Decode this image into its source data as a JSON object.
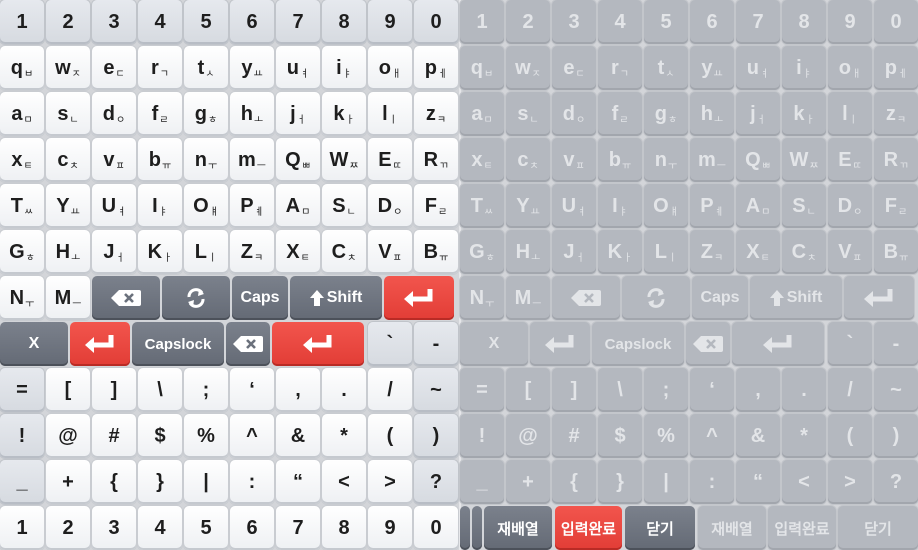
{
  "rows": [
    {
      "left": [
        {
          "p": "1",
          "s": "",
          "st": "l"
        },
        {
          "p": "2",
          "s": "",
          "st": "l"
        },
        {
          "p": "3",
          "s": "",
          "st": "l"
        },
        {
          "p": "4",
          "s": "",
          "st": "l"
        },
        {
          "p": "5",
          "s": "",
          "st": "l"
        },
        {
          "p": "6",
          "s": "",
          "st": "l"
        },
        {
          "p": "7",
          "s": "",
          "st": "l"
        },
        {
          "p": "8",
          "s": "",
          "st": "l"
        },
        {
          "p": "9",
          "s": "",
          "st": "l"
        },
        {
          "p": "0",
          "s": "",
          "st": "l"
        }
      ]
    },
    {
      "left": [
        {
          "p": "q",
          "s": "ㅂ",
          "st": "w"
        },
        {
          "p": "w",
          "s": "ㅈ",
          "st": "w"
        },
        {
          "p": "e",
          "s": "ㄷ",
          "st": "w"
        },
        {
          "p": "r",
          "s": "ㄱ",
          "st": "w"
        },
        {
          "p": "t",
          "s": "ㅅ",
          "st": "w"
        },
        {
          "p": "y",
          "s": "ㅛ",
          "st": "w"
        },
        {
          "p": "u",
          "s": "ㅕ",
          "st": "w"
        },
        {
          "p": "i",
          "s": "ㅑ",
          "st": "w"
        },
        {
          "p": "o",
          "s": "ㅐ",
          "st": "w"
        },
        {
          "p": "p",
          "s": "ㅔ",
          "st": "w"
        }
      ]
    },
    {
      "left": [
        {
          "p": "a",
          "s": "ㅁ",
          "st": "w"
        },
        {
          "p": "s",
          "s": "ㄴ",
          "st": "w"
        },
        {
          "p": "d",
          "s": "ㅇ",
          "st": "w"
        },
        {
          "p": "f",
          "s": "ㄹ",
          "st": "w"
        },
        {
          "p": "g",
          "s": "ㅎ",
          "st": "w"
        },
        {
          "p": "h",
          "s": "ㅗ",
          "st": "w"
        },
        {
          "p": "j",
          "s": "ㅓ",
          "st": "w"
        },
        {
          "p": "k",
          "s": "ㅏ",
          "st": "w"
        },
        {
          "p": "l",
          "s": "ㅣ",
          "st": "w"
        },
        {
          "p": "z",
          "s": "ㅋ",
          "st": "w"
        }
      ]
    },
    {
      "left": [
        {
          "p": "x",
          "s": "ㅌ",
          "st": "w"
        },
        {
          "p": "c",
          "s": "ㅊ",
          "st": "w"
        },
        {
          "p": "v",
          "s": "ㅍ",
          "st": "w"
        },
        {
          "p": "b",
          "s": "ㅠ",
          "st": "w"
        },
        {
          "p": "n",
          "s": "ㅜ",
          "st": "w"
        },
        {
          "p": "m",
          "s": "ㅡ",
          "st": "w"
        },
        {
          "p": "Q",
          "s": "ㅃ",
          "st": "w"
        },
        {
          "p": "W",
          "s": "ㅉ",
          "st": "w"
        },
        {
          "p": "E",
          "s": "ㄸ",
          "st": "w"
        },
        {
          "p": "R",
          "s": "ㄲ",
          "st": "w"
        }
      ]
    },
    {
      "left": [
        {
          "p": "T",
          "s": "ㅆ",
          "st": "w"
        },
        {
          "p": "Y",
          "s": "ㅛ",
          "st": "w"
        },
        {
          "p": "U",
          "s": "ㅕ",
          "st": "w"
        },
        {
          "p": "I",
          "s": "ㅑ",
          "st": "w"
        },
        {
          "p": "O",
          "s": "ㅒ",
          "st": "w"
        },
        {
          "p": "P",
          "s": "ㅖ",
          "st": "w"
        },
        {
          "p": "A",
          "s": "ㅁ",
          "st": "w"
        },
        {
          "p": "S",
          "s": "ㄴ",
          "st": "w"
        },
        {
          "p": "D",
          "s": "ㅇ",
          "st": "w"
        },
        {
          "p": "F",
          "s": "ㄹ",
          "st": "w"
        }
      ]
    },
    {
      "left": [
        {
          "p": "G",
          "s": "ㅎ",
          "st": "w"
        },
        {
          "p": "H",
          "s": "ㅗ",
          "st": "w"
        },
        {
          "p": "J",
          "s": "ㅓ",
          "st": "w"
        },
        {
          "p": "K",
          "s": "ㅏ",
          "st": "w"
        },
        {
          "p": "L",
          "s": "ㅣ",
          "st": "w"
        },
        {
          "p": "Z",
          "s": "ㅋ",
          "st": "w"
        },
        {
          "p": "X",
          "s": "ㅌ",
          "st": "w"
        },
        {
          "p": "C",
          "s": "ㅊ",
          "st": "w"
        },
        {
          "p": "V",
          "s": "ㅍ",
          "st": "w"
        },
        {
          "p": "B",
          "s": "ㅠ",
          "st": "w"
        }
      ]
    },
    {
      "left": [
        {
          "p": "N",
          "s": "ㅜ",
          "st": "w"
        },
        {
          "p": "M",
          "s": "ㅡ",
          "st": "w"
        },
        {
          "icon": "backspace-icon",
          "st": "d"
        },
        {
          "icon": "refresh-icon",
          "st": "d"
        },
        {
          "p": "Caps",
          "s": "",
          "st": "d",
          "lab": 1
        },
        {
          "p": "Shift",
          "s": "",
          "st": "d",
          "lab": 1,
          "icon": "shift-arrow-icon"
        },
        {
          "icon": "enter-icon",
          "st": "r"
        }
      ]
    },
    {
      "left": [
        {
          "p": "X",
          "s": "",
          "st": "d",
          "lab": 1
        },
        {
          "icon": "enter-icon",
          "st": "r"
        },
        {
          "p": "Capslock",
          "s": "",
          "st": "d",
          "lab": 1
        },
        {
          "icon": "backspace-icon",
          "st": "d"
        },
        {
          "icon": "enter-icon",
          "st": "r"
        },
        {
          "p": "`",
          "s": "",
          "st": "l"
        },
        {
          "p": "-",
          "s": "",
          "st": "l"
        }
      ]
    },
    {
      "left": [
        {
          "p": "=",
          "s": "",
          "st": "l"
        },
        {
          "p": "[",
          "s": "",
          "st": "w"
        },
        {
          "p": "]",
          "s": "",
          "st": "w"
        },
        {
          "p": "\\",
          "s": "",
          "st": "w"
        },
        {
          "p": ";",
          "s": "",
          "st": "w"
        },
        {
          "p": "‘",
          "s": "",
          "st": "w"
        },
        {
          "p": ",",
          "s": "",
          "st": "w"
        },
        {
          "p": ".",
          "s": "",
          "st": "w"
        },
        {
          "p": "/",
          "s": "",
          "st": "w"
        },
        {
          "p": "~",
          "s": "",
          "st": "l"
        }
      ]
    },
    {
      "left": [
        {
          "p": "!",
          "s": "",
          "st": "l"
        },
        {
          "p": "@",
          "s": "",
          "st": "w"
        },
        {
          "p": "#",
          "s": "",
          "st": "w"
        },
        {
          "p": "$",
          "s": "",
          "st": "w"
        },
        {
          "p": "%",
          "s": "",
          "st": "w"
        },
        {
          "p": "^",
          "s": "",
          "st": "w"
        },
        {
          "p": "&",
          "s": "",
          "st": "w"
        },
        {
          "p": "*",
          "s": "",
          "st": "w"
        },
        {
          "p": "(",
          "s": "",
          "st": "w"
        },
        {
          "p": ")",
          "s": "",
          "st": "l"
        }
      ]
    },
    {
      "left": [
        {
          "p": "_",
          "s": "",
          "st": "l"
        },
        {
          "p": "+",
          "s": "",
          "st": "w"
        },
        {
          "p": "{",
          "s": "",
          "st": "w"
        },
        {
          "p": "}",
          "s": "",
          "st": "w"
        },
        {
          "p": "|",
          "s": "",
          "st": "w"
        },
        {
          "p": ":",
          "s": "",
          "st": "w"
        },
        {
          "p": "“",
          "s": "",
          "st": "w"
        },
        {
          "p": "<",
          "s": "",
          "st": "w"
        },
        {
          "p": ">",
          "s": "",
          "st": "w"
        },
        {
          "p": "?",
          "s": "",
          "st": "l"
        }
      ]
    },
    {
      "left": [
        {
          "p": "1",
          "s": "",
          "st": "w"
        },
        {
          "p": "2",
          "s": "",
          "st": "w"
        },
        {
          "p": "3",
          "s": "",
          "st": "w"
        },
        {
          "p": "4",
          "s": "",
          "st": "w"
        },
        {
          "p": "5",
          "s": "",
          "st": "w"
        },
        {
          "p": "6",
          "s": "",
          "st": "w"
        },
        {
          "p": "7",
          "s": "",
          "st": "w"
        },
        {
          "p": "8",
          "s": "",
          "st": "w"
        },
        {
          "p": "9",
          "s": "",
          "st": "w"
        },
        {
          "p": "0",
          "s": "",
          "st": "w"
        }
      ]
    }
  ],
  "actions": {
    "rearrange": "재배열",
    "complete": "입력완료",
    "close": "닫기"
  },
  "colors": {
    "accent": "#e8463f",
    "dark": "#6b717c",
    "disabled": "#b4b8bf",
    "background": "#d3d5d9"
  }
}
